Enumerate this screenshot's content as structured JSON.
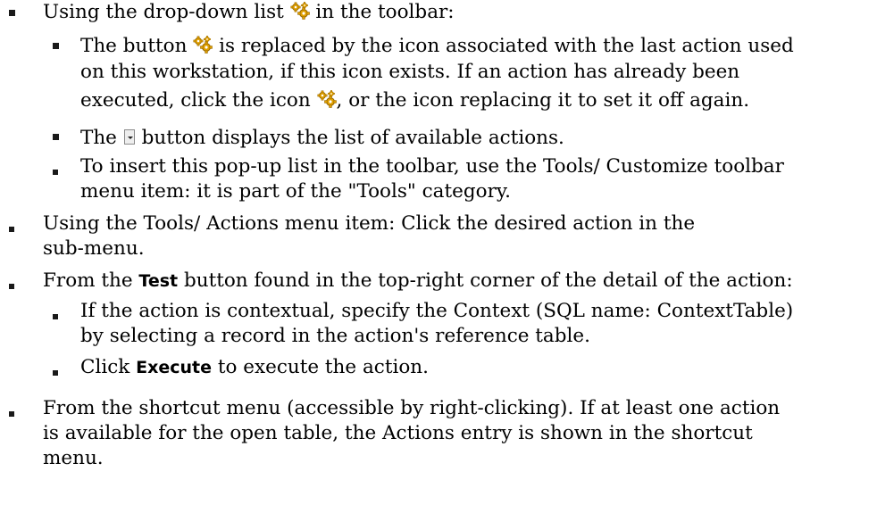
{
  "items": [
    {
      "pre": "Using the drop-down list ",
      "post": " in the toolbar:"
    },
    {
      "l1_pre": "The button ",
      "l1_post": " is replaced by the icon associated with the last action used",
      "l2": "on this workstation, if this icon exists. If an action has already been",
      "l3_pre": "executed, click the icon ",
      "l3_post": ", or the icon replacing it to set it off again."
    },
    {
      "pre": "The ",
      "post": " button displays the list of available actions."
    },
    {
      "l1": "To insert this pop-up list in the toolbar, use the Tools/ Customize toolbar",
      "l2": "menu item: it is part of the \"Tools\" category."
    },
    {
      "l1": "Using the Tools/ Actions menu item: Click the desired action in the",
      "l2": "sub-menu."
    },
    {
      "pre": "From the ",
      "bold": "Test",
      "post": " button found in the top-right corner of the detail of the action:"
    },
    {
      "l1": "If the action is contextual, specify the Context (SQL name: ContextTable)",
      "l2": "by selecting a record in the action's reference table."
    },
    {
      "pre": "Click ",
      "bold": "Execute",
      "post": " to execute the action."
    },
    {
      "l1": "From the shortcut menu (accessible by right-clicking). If at least one action",
      "l2": "is available for the open table, the Actions entry is shown in the shortcut",
      "l3": "menu."
    }
  ]
}
